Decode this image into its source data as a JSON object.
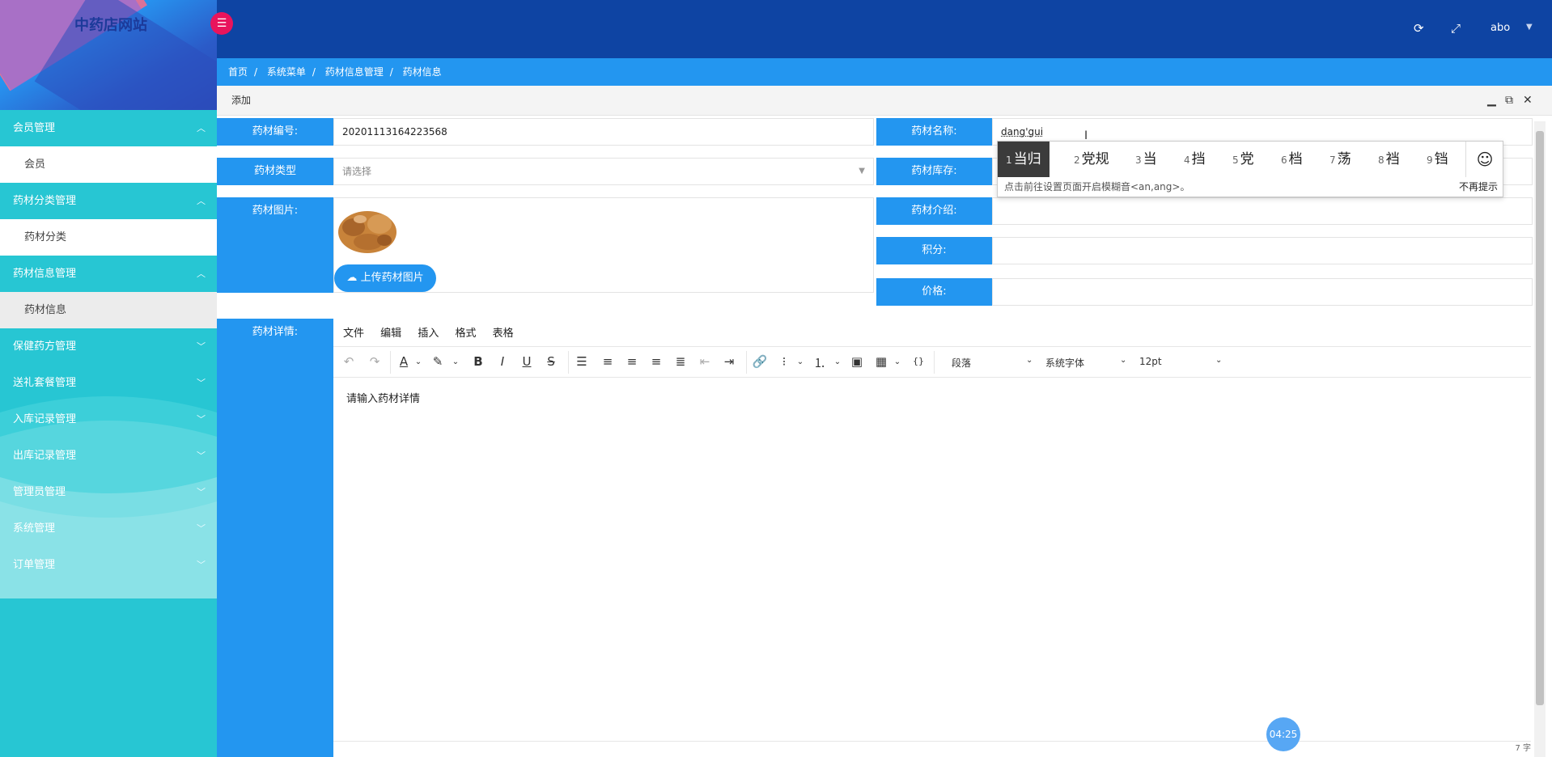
{
  "app": {
    "title": "中药店网站",
    "user": "abo"
  },
  "sidebar": {
    "groups": [
      {
        "label": "会员管理",
        "sub": "会员",
        "active": false
      },
      {
        "label": "药材分类管理",
        "sub": "药材分类",
        "active": false
      },
      {
        "label": "药材信息管理",
        "sub": "药材信息",
        "active": true
      },
      {
        "label": "保健药方管理"
      },
      {
        "label": "送礼套餐管理"
      },
      {
        "label": "入库记录管理"
      },
      {
        "label": "出库记录管理"
      },
      {
        "label": "管理员管理"
      },
      {
        "label": "系统管理"
      },
      {
        "label": "订单管理"
      }
    ]
  },
  "breadcrumb": [
    "首页",
    "系统菜单",
    "药材信息管理",
    "药材信息"
  ],
  "panel": {
    "title": "添加"
  },
  "form": {
    "code_label": "药材编号:",
    "code_value": "20201113164223568",
    "type_label": "药材类型",
    "type_placeholder": "请选择",
    "image_label": "药材图片:",
    "upload_label": "上传药材图片",
    "name_label": "药材名称:",
    "name_value": "dang'gui",
    "stock_label": "药材库存:",
    "intro_label": "药材介绍:",
    "points_label": "积分:",
    "price_label": "价格:",
    "detail_label": "药材详情:"
  },
  "editor": {
    "menus": [
      "文件",
      "编辑",
      "插入",
      "格式",
      "表格"
    ],
    "block_format": "段落",
    "font_family": "系统字体",
    "font_size": "12pt",
    "placeholder": "请输入药材详情",
    "word_count": "7 字"
  },
  "ime": {
    "candidates": [
      {
        "n": "1",
        "text": "当归"
      },
      {
        "n": "2",
        "text": "党规"
      },
      {
        "n": "3",
        "text": "当"
      },
      {
        "n": "4",
        "text": "挡"
      },
      {
        "n": "5",
        "text": "党"
      },
      {
        "n": "6",
        "text": "档"
      },
      {
        "n": "7",
        "text": "荡"
      },
      {
        "n": "8",
        "text": "裆"
      },
      {
        "n": "9",
        "text": "铛"
      }
    ],
    "hint": "点击前往设置页面开启模糊音<an,ang>。",
    "dismiss": "不再提示"
  },
  "timer": "04:25",
  "colors": {
    "sidebar": "#27c6d3",
    "topbar": "#0e44a3",
    "accent": "#2396f0",
    "toggle": "#e8145c"
  }
}
